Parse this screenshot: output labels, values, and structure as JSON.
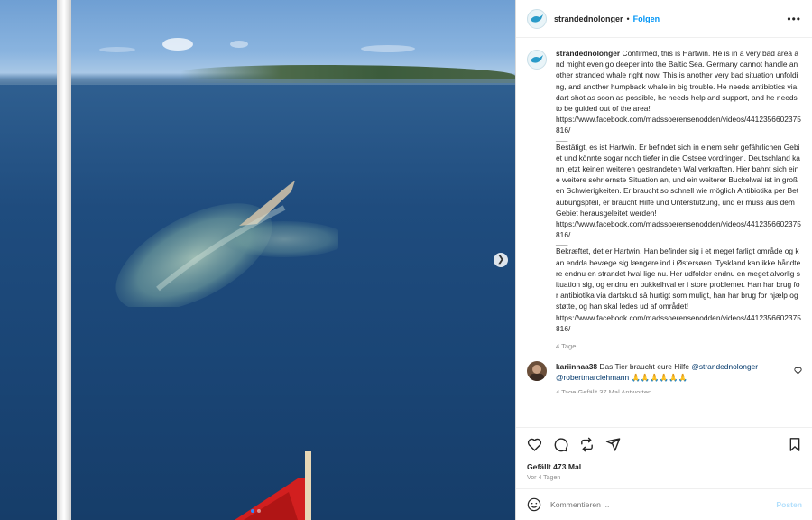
{
  "post": {
    "username": "strandednolonger",
    "separator": "•",
    "follow_label": "Folgen",
    "more_icon": "more-horizontal-icon"
  },
  "caption": {
    "username": "strandednolonger",
    "block_en": " Confirmed, this is Hartwin. He is in a very bad area and might even go deeper into the Baltic Sea. Germany cannot handle another stranded whale right now. This is another very bad situation unfolding, and another humpback whale in big trouble. He needs antibiotics via dart shot as soon as possible, he needs help and support, and he needs to be guided out of the area!",
    "link_en": "https://www.facebook.com/madssoerensenodden/videos/4412356602375816/",
    "block_de": "Bestätigt, es ist Hartwin. Er befindet sich in einem sehr gefährlichen Gebiet und könnte sogar noch tiefer in die Ostsee vordringen. Deutschland kann jetzt keinen weiteren gestrandeten Wal verkraften. Hier bahnt sich eine weitere sehr ernste Situation an, und ein weiterer Buckelwal ist in großen Schwierigkeiten. Er braucht so schnell wie möglich Antibiotika per Betäubungspfeil, er braucht Hilfe und Unterstützung, und er muss aus dem Gebiet herausgeleitet werden!",
    "link_de": "https://www.facebook.com/madssoerensenodden/videos/4412356602375816/",
    "block_da": "Bekræftet, det er Hartwin. Han befinder sig i et meget farligt område og kan endda bevæge sig længere ind i Østersøen. Tyskland kan ikke håndtere endnu en strandet hval lige nu. Her udfolder endnu en meget alvorlig situation sig, og endnu en pukkelhval er i store problemer. Han har brug for antibiotika via dartskud så hurtigt som muligt, han har brug for hjælp og støtte, og han skal ledes ud af området!",
    "link_da": "https://www.facebook.com/madssoerensenodden/videos/4412356602375816/",
    "rule": "____",
    "time": "4 Tage"
  },
  "comment": {
    "username": "kariinnaa38",
    "text": " Das Tier braucht eure Hilfe ",
    "mention1": "@strandednolonger",
    "mention2": "@robertmarclehmann",
    "emojis": " 🙏🙏🙏🙏🙏🙏",
    "meta": "4 Tage   Gefällt 37 Mal   Antworten"
  },
  "actions": {
    "likes": "Gefällt 473 Mal",
    "date": "Vor 4 Tagen"
  },
  "add_comment": {
    "placeholder": "Kommentieren ...",
    "post_label": "Posten"
  },
  "colors": {
    "follow": "#0095f6",
    "post_disabled": "#b2dffc",
    "carousel_active": "#2e8cff"
  }
}
